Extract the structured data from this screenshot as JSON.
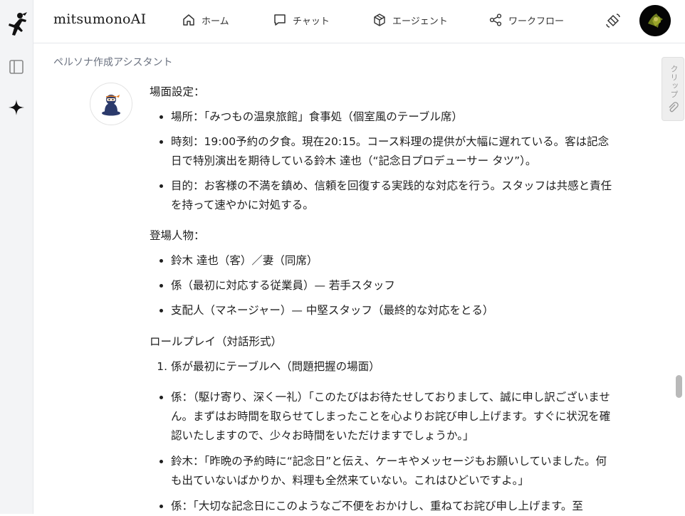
{
  "header": {
    "brand": "mitsumonoAI",
    "nav": [
      {
        "label": "ホーム",
        "icon": "home-icon"
      },
      {
        "label": "チャット",
        "icon": "chat-icon"
      },
      {
        "label": "エージェント",
        "icon": "cube-icon"
      },
      {
        "label": "ワークフロー",
        "icon": "share-icon"
      }
    ],
    "right_icon": "satellite-icon",
    "avatar_icon": "user-avatar"
  },
  "sidebar": {
    "icons": [
      "ninja-logo-icon",
      "sidebar-toggle-icon",
      "sparkle-icon"
    ]
  },
  "breadcrumb": "ペルソナ作成アシスタント",
  "clip": {
    "label": "クリップ",
    "icon": "paperclip-icon"
  },
  "message": {
    "scene_heading": "場面設定：",
    "scene_items": [
      "場所：「みつもの温泉旅館」食事処（個室風のテーブル席）",
      "時刻：19:00予約の夕食。現在20:15。コース料理の提供が大幅に遅れている。客は記念日で特別演出を期待している鈴木 達也（“記念日プロデューサー タツ”）。",
      "目的：お客様の不満を鎮め、信頼を回復する実践的な対応を行う。スタッフは共感と責任を持って速やかに対処する。"
    ],
    "characters_heading": "登場人物：",
    "characters": [
      "鈴木 達也（客）／妻（同席）",
      "係（最初に対応する従業員）— 若手スタッフ",
      "支配人（マネージャー）— 中堅スタッフ（最終的な対応をとる）"
    ],
    "roleplay_heading": "ロールプレイ（対話形式）",
    "step1": "係が最初にテーブルへ（問題把握の場面）",
    "dialogue": [
      "係：（駆け寄り、深く一礼）「このたびはお待たせしておりまして、誠に申し訳ございません。まずはお時間を取らせてしまったことを心よりお詫び申し上げます。すぐに状況を確認いたしますので、少々お時間をいただけますでしょうか。」",
      "鈴木：「昨晩の予約時に“記念日”と伝え、ケーキやメッセージもお願いしていました。何も出ていないばかりか、料理も全然来ていない。これはひどいですよ。」",
      "係：「大切な記念日にこのようなご不便をおかけし、重ねてお詫び申し上げます。至"
    ]
  }
}
